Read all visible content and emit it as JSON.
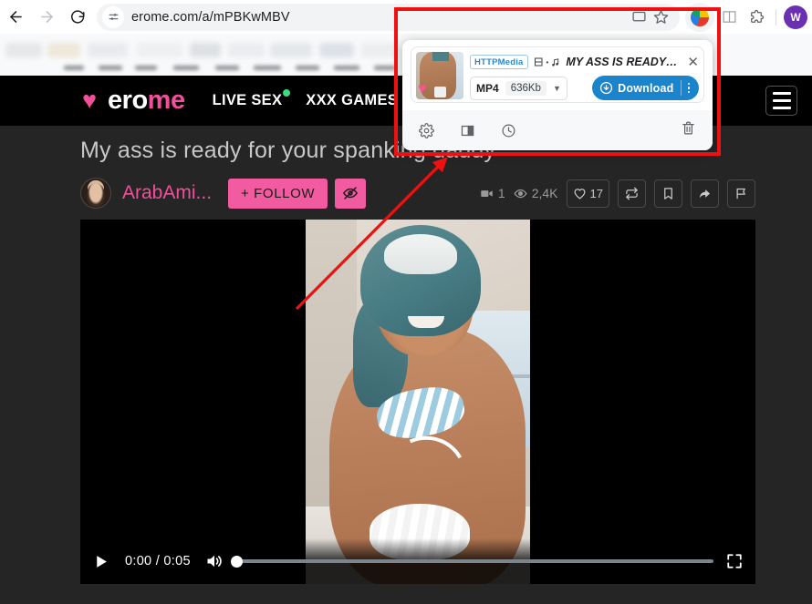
{
  "browser": {
    "back_icon": "back-arrow-icon",
    "forward_icon": "forward-arrow-icon",
    "reload_icon": "reload-icon",
    "site_info_icon": "site-settings-icon",
    "url": "erome.com/a/mPBKwMBV",
    "cast_icon": "cast-icon",
    "bookmark_star_icon": "bookmark-star-icon",
    "extension_blob_icon": "httpmedia-extension-icon",
    "extensions_puzzle_icon": "extensions-puzzle-icon",
    "profile_initial": "W"
  },
  "site": {
    "logo": {
      "heart": "♥",
      "text_white": "ero",
      "text_pink": "me"
    },
    "nav": [
      {
        "label": "LIVE SEX",
        "dot": true
      },
      {
        "label": "XXX GAMES",
        "dot": false
      }
    ],
    "menu_icon": "hamburger-menu-icon",
    "album_title": "My ass is ready for your spanking daddy",
    "username": "ArabAmi...",
    "follow_label": "+ FOLLOW",
    "hide_icon": "eye-slash-icon",
    "stats": {
      "video_count_icon": "video-camera-icon",
      "video_count": "1",
      "views_icon": "eye-icon",
      "views": "2,4K"
    },
    "actions": [
      {
        "name": "like-button",
        "icon": "heart-outline-icon",
        "count": "17"
      },
      {
        "name": "repost-button",
        "icon": "repeat-icon",
        "count": ""
      },
      {
        "name": "bookmark-button",
        "icon": "bookmark-icon",
        "count": ""
      },
      {
        "name": "share-button",
        "icon": "share-arrow-icon",
        "count": ""
      },
      {
        "name": "report-button",
        "icon": "flag-icon",
        "count": ""
      }
    ]
  },
  "player": {
    "play_icon": "play-icon",
    "time": "0:00 / 0:05",
    "volume_icon": "volume-icon",
    "fullscreen_icon": "fullscreen-icon",
    "progress_percent": 0
  },
  "popup": {
    "badge": "HTTPMedia",
    "type_icon": "video-audio-icon",
    "title": "MY ASS IS READY F...",
    "close_icon": "close-icon",
    "format": "MP4",
    "size": "636Kb",
    "dropdown_icon": "chevron-down-icon",
    "download_label": "Download",
    "download_icon": "download-circle-icon",
    "kebab_icon": "more-options-icon",
    "toolbar": [
      {
        "name": "settings-button",
        "icon": "gear-icon"
      },
      {
        "name": "sidepanel-button",
        "icon": "panel-icon"
      },
      {
        "name": "history-button",
        "icon": "clock-icon"
      }
    ],
    "trash_icon": "trash-icon"
  },
  "annotation": {
    "highlight_color": "#ee1111",
    "arrow_color": "#ee1111"
  }
}
